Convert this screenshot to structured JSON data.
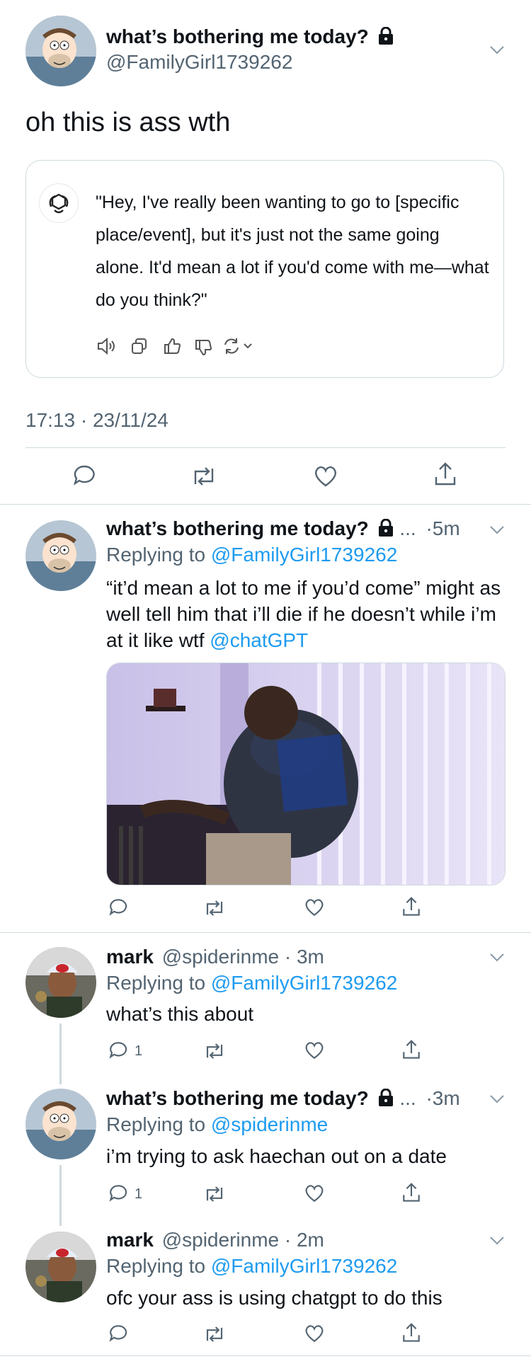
{
  "main_tweet": {
    "display_name": "what’s bothering me today?",
    "handle": "@FamilyGirl1739262",
    "text": "oh this is ass wth",
    "chatgpt_message": "\"Hey, I've really been wanting to go to [specific place/event], but it's just not the same going alone. It'd mean a lot if you'd come with me—what do you think?\"",
    "timestamp": "17:13 · 23/11/24"
  },
  "replies": [
    {
      "display_name": "what’s bothering me today?",
      "ellipsis": "...",
      "time": "·5m",
      "replying_prefix": "Replying to",
      "replying_to": "@FamilyGirl1739262",
      "text_plain": "“it’d mean a lot to me if you’d come” might as well tell him that i’ll die if he doesn’t while i’m at it like wtf ",
      "text_mention": "@chatGPT"
    },
    {
      "display_name": "mark",
      "handle_time": "@spiderinme · 3m",
      "replying_prefix": "Replying to",
      "replying_to": "@FamilyGirl1739262",
      "text": "what’s this about",
      "reply_count": "1"
    },
    {
      "display_name": "what’s bothering me today?",
      "ellipsis": "...",
      "time": "·3m",
      "replying_prefix": "Replying to",
      "replying_to": "@spiderinme",
      "text": "i’m trying to ask haechan out on a date",
      "reply_count": "1"
    },
    {
      "display_name": "mark",
      "handle_time": "@spiderinme · 2m",
      "replying_prefix": "Replying to",
      "replying_to": "@FamilyGirl1739262",
      "text": "ofc your ass is using chatgpt to do this"
    }
  ],
  "colors": {
    "link": "#1d9bf0",
    "secondary": "#536471",
    "divider": "#cfd9de"
  }
}
